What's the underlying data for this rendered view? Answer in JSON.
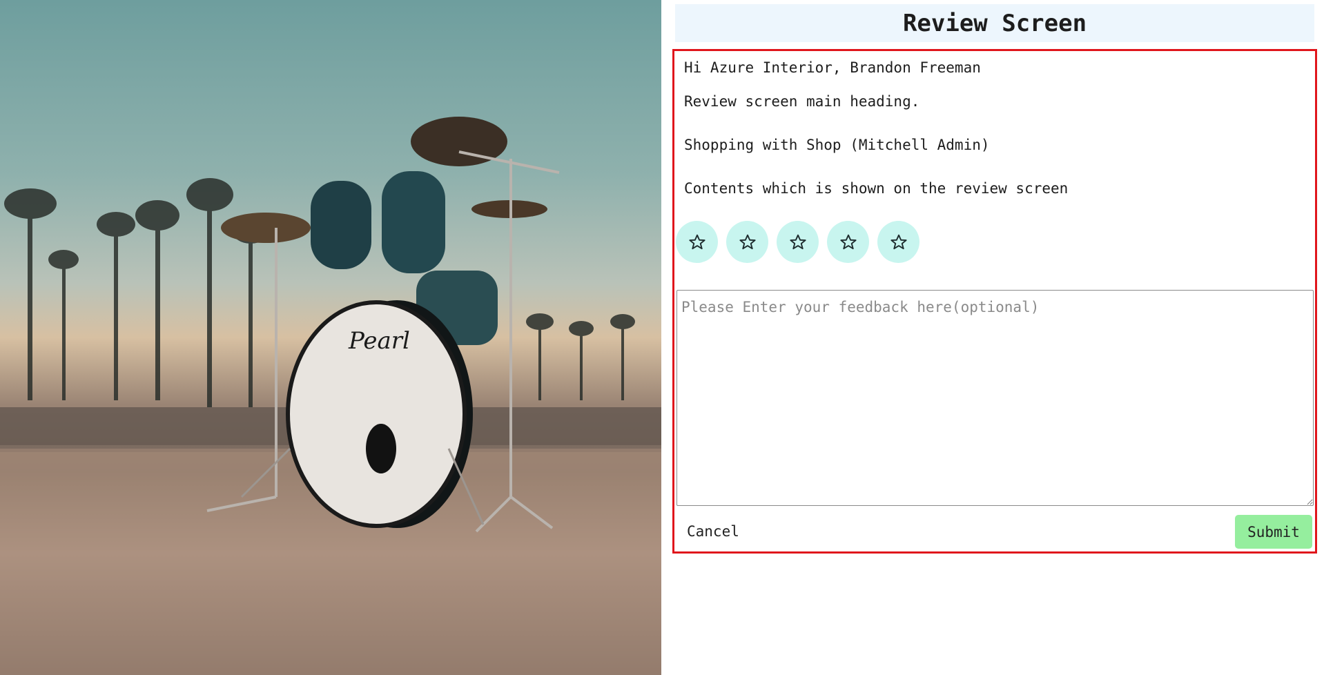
{
  "photo": {
    "alt": "Drum kit on pavement with palm trees at sunset",
    "drum_brand": "Pearl"
  },
  "review": {
    "title": "Review Screen",
    "greeting": "Hi Azure Interior, Brandon Freeman",
    "main_heading": "Review screen main heading.",
    "shopping_with": "Shopping with Shop (Mitchell Admin)",
    "contents": "Contents which is shown on the review screen",
    "rating": {
      "max": 5,
      "selected": 0,
      "icon": "star-outline-icon",
      "button_color": "#c8f5ef"
    },
    "feedback": {
      "placeholder": "Please Enter your feedback here(optional)",
      "value": ""
    },
    "cancel_label": "Cancel",
    "submit_label": "Submit",
    "colors": {
      "title_bg": "#edf6fd",
      "frame_border": "#e0161c",
      "submit_bg": "#95ee9e"
    }
  }
}
